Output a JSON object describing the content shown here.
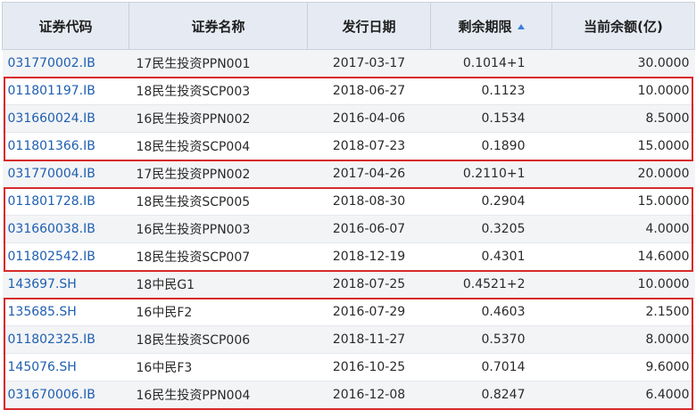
{
  "columns": [
    "证券代码",
    "证券名称",
    "发行日期",
    "剩余期限",
    "当前余额(亿)"
  ],
  "sort": {
    "column": "剩余期限",
    "direction": "ascending"
  },
  "rows": [
    {
      "code": "031770002.IB",
      "name": "17民生投资PPN001",
      "date": "2017-03-17",
      "remaining": "0.1014+1",
      "balance": "30.0000"
    },
    {
      "code": "011801197.IB",
      "name": "18民生投资SCP003",
      "date": "2018-06-27",
      "remaining": "0.1123",
      "balance": "10.0000"
    },
    {
      "code": "031660024.IB",
      "name": "16民生投资PPN002",
      "date": "2016-04-06",
      "remaining": "0.1534",
      "balance": "8.5000"
    },
    {
      "code": "011801366.IB",
      "name": "18民生投资SCP004",
      "date": "2018-07-23",
      "remaining": "0.1890",
      "balance": "15.0000"
    },
    {
      "code": "031770004.IB",
      "name": "17民生投资PPN002",
      "date": "2017-04-26",
      "remaining": "0.2110+1",
      "balance": "20.0000"
    },
    {
      "code": "011801728.IB",
      "name": "18民生投资SCP005",
      "date": "2018-08-30",
      "remaining": "0.2904",
      "balance": "15.0000"
    },
    {
      "code": "031660038.IB",
      "name": "16民生投资PPN003",
      "date": "2016-06-07",
      "remaining": "0.3205",
      "balance": "4.0000"
    },
    {
      "code": "011802542.IB",
      "name": "18民生投资SCP007",
      "date": "2018-12-19",
      "remaining": "0.4301",
      "balance": "14.6000"
    },
    {
      "code": "143697.SH",
      "name": "18中民G1",
      "date": "2018-07-25",
      "remaining": "0.4521+2",
      "balance": "10.0000"
    },
    {
      "code": "135685.SH",
      "name": "16中民F2",
      "date": "2016-07-29",
      "remaining": "0.4603",
      "balance": "2.1500"
    },
    {
      "code": "011802325.IB",
      "name": "18民生投资SCP006",
      "date": "2018-11-27",
      "remaining": "0.5370",
      "balance": "8.0000"
    },
    {
      "code": "145076.SH",
      "name": "16中民F3",
      "date": "2016-10-25",
      "remaining": "0.7014",
      "balance": "9.6000"
    },
    {
      "code": "031670006.IB",
      "name": "16民生投资PPN004",
      "date": "2016-12-08",
      "remaining": "0.8247",
      "balance": "6.4000"
    }
  ],
  "highlight_groups": [
    {
      "first_row": 1,
      "last_row": 3
    },
    {
      "first_row": 5,
      "last_row": 7
    },
    {
      "first_row": 9,
      "last_row": 12
    }
  ],
  "colors": {
    "header_bg": "#e6ebf3",
    "code_link": "#1f5fb0",
    "highlight": "#d72a2a",
    "sort_arrow": "#3b7ddd"
  },
  "icons": {
    "sort": "sort-asc-icon"
  }
}
